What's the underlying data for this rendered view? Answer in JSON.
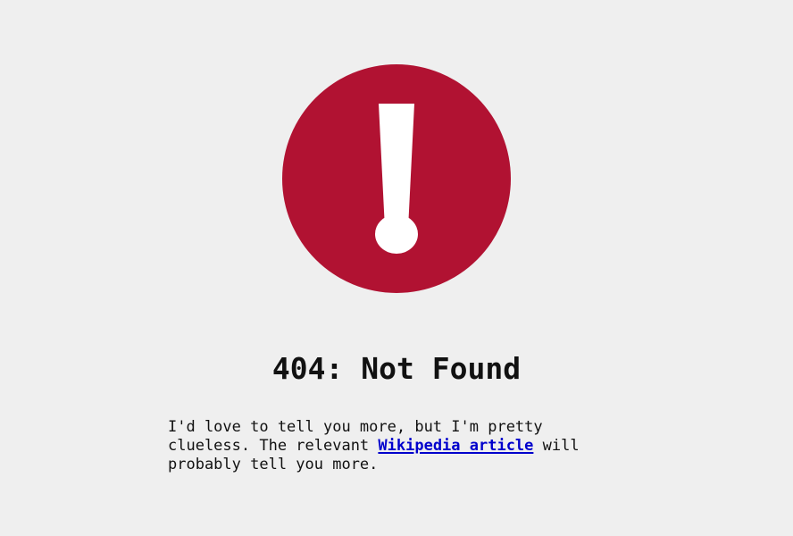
{
  "colors": {
    "background": "#efefef",
    "alert": "#b11232",
    "text": "#111111",
    "link": "#0000cc"
  },
  "icon": {
    "name": "exclamation-circle-icon"
  },
  "error": {
    "title": "404: Not Found",
    "message_part1": "I'd love to tell you more, but I'm pretty clueless. The relevant ",
    "link_text": "Wikipedia article",
    "message_part2": " will probably tell you more."
  }
}
